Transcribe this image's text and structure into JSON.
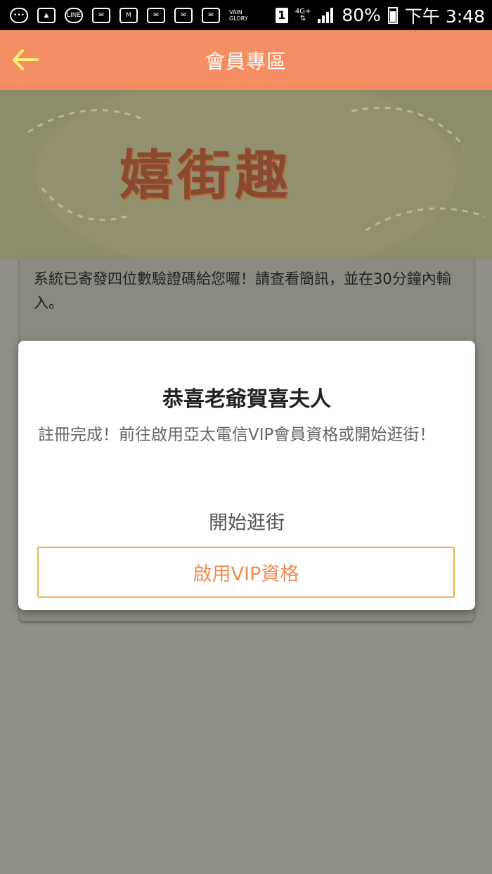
{
  "status_bar": {
    "notification_icons": [
      "chat-icon",
      "image-icon",
      "line-icon",
      "mail-icon",
      "gmail-icon",
      "mail-icon",
      "mail-icon",
      "mail-icon",
      "vainglory-icon"
    ],
    "line_label": "LINE",
    "game_label": "VAIN GLORY",
    "sim": "1",
    "network": "4G+",
    "battery": "80%",
    "time": "下午 3:48"
  },
  "app_bar": {
    "title": "會員專區",
    "back_icon": "arrow-left-icon",
    "back_color": "#fff176",
    "color": "#f58e63"
  },
  "banner": {
    "logo_text": "嬉街趣"
  },
  "verify": {
    "message": "系統已寄發四位數驗證碼給您囉！請查看簡訊，並在30分鐘內輸入。"
  },
  "dialog": {
    "title": "恭喜老爺賀喜夫人",
    "message": "註冊完成！前往啟用亞太電信VIP會員資格或開始逛街！",
    "start_label": "開始逛街",
    "vip_label": "啟用VIP資格",
    "vip_border_color": "#f0b24b",
    "vip_text_color": "#f08a55"
  }
}
